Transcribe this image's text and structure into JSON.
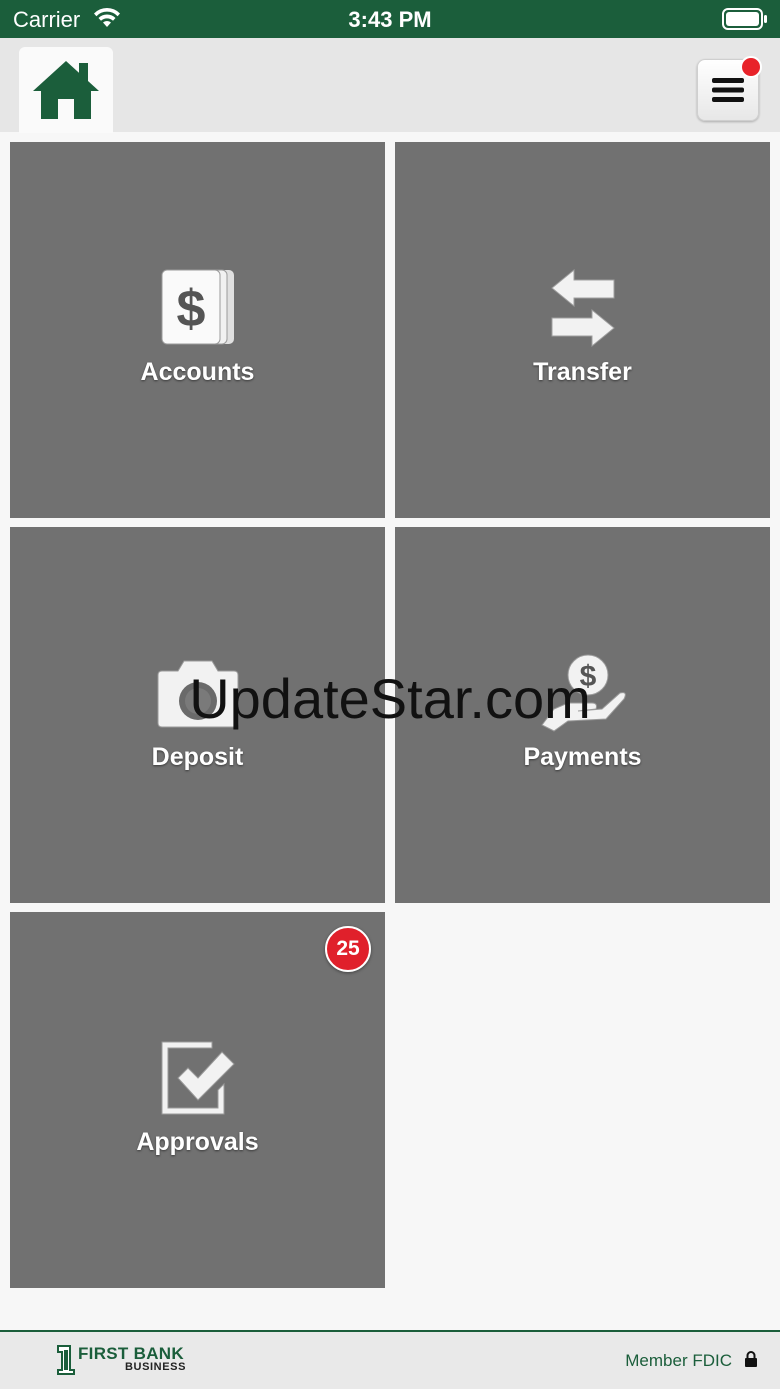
{
  "status_bar": {
    "carrier": "Carrier",
    "time": "3:43 PM"
  },
  "header": {
    "home_icon": "home-icon",
    "menu_icon": "hamburger-menu-icon",
    "menu_has_notification": true
  },
  "tiles": [
    {
      "label": "Accounts",
      "icon": "dollar-bills-icon"
    },
    {
      "label": "Transfer",
      "icon": "transfer-arrows-icon"
    },
    {
      "label": "Deposit",
      "icon": "camera-icon"
    },
    {
      "label": "Payments",
      "icon": "hand-coin-icon"
    },
    {
      "label": "Approvals",
      "icon": "checkbox-check-icon",
      "badge": "25"
    }
  ],
  "watermark": "UpdateStar.com",
  "footer": {
    "logo_line1": "FIRST BANK",
    "logo_line2": "BUSINESS",
    "fdic": "Member FDIC",
    "lock_icon": "lock-icon"
  },
  "colors": {
    "brand_green": "#1b5e3b",
    "tile_gray": "#717171",
    "badge_red": "#e0202b"
  }
}
